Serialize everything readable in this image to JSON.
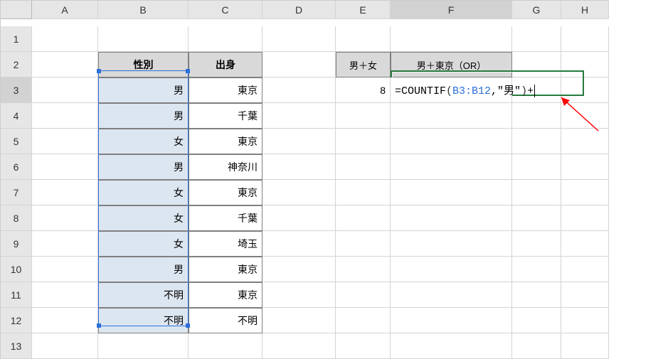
{
  "columns": [
    "A",
    "B",
    "C",
    "D",
    "E",
    "F",
    "G",
    "H"
  ],
  "rows": [
    "1",
    "2",
    "3",
    "4",
    "5",
    "6",
    "7",
    "8",
    "9",
    "10",
    "11",
    "12",
    "13"
  ],
  "headers": {
    "B2": "性別",
    "C2": "出身",
    "E2": "男＋女",
    "F2": "男＋東京（OR）"
  },
  "data": {
    "B": [
      "男",
      "男",
      "女",
      "男",
      "女",
      "女",
      "女",
      "男",
      "不明",
      "不明"
    ],
    "C": [
      "東京",
      "千葉",
      "東京",
      "神奈川",
      "東京",
      "千葉",
      "埼玉",
      "東京",
      "東京",
      "不明"
    ]
  },
  "E3": "8",
  "formula": {
    "prefix": "=COUNTIF",
    "open": "(",
    "ref": "B3:B12",
    "mid": ",\"男\"",
    "close": ")",
    "suffix": "+"
  },
  "active_cell": "F3",
  "selected_range": "B3:C12",
  "chart_data": {
    "type": "table",
    "columns": [
      "性別",
      "出身"
    ],
    "rows": [
      [
        "男",
        "東京"
      ],
      [
        "男",
        "千葉"
      ],
      [
        "女",
        "東京"
      ],
      [
        "男",
        "神奈川"
      ],
      [
        "女",
        "東京"
      ],
      [
        "女",
        "千葉"
      ],
      [
        "女",
        "埼玉"
      ],
      [
        "男",
        "東京"
      ],
      [
        "不明",
        "東京"
      ],
      [
        "不明",
        "不明"
      ]
    ],
    "summary": {
      "男＋女": 8
    },
    "formula_in_progress": "=COUNTIF(B3:B12,\"男\")+"
  }
}
